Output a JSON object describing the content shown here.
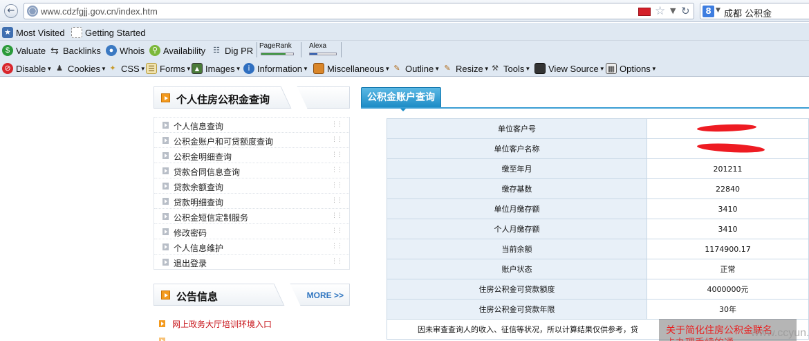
{
  "browser": {
    "url": "www.cdzfgjj.gov.cn/index.htm",
    "search_text": "成都 公积金",
    "search_engine_icon": "8"
  },
  "bookmarks": [
    {
      "label": "Most Visited",
      "icon": "bookmarks-icon"
    },
    {
      "label": "Getting Started",
      "icon": "page-icon"
    }
  ],
  "seo_toolbar": {
    "items": [
      {
        "label": "Valuate",
        "icon": "dollar-icon"
      },
      {
        "label": "Backlinks",
        "icon": "arrows-icon"
      },
      {
        "label": "Whois",
        "icon": "globe-icon"
      },
      {
        "label": "Availability",
        "icon": "magnifier-icon"
      },
      {
        "label": "Dig PR",
        "icon": "network-icon"
      }
    ],
    "pagerank_label": "PageRank",
    "alexa_label": "Alexa",
    "pagerank_level": 0.75,
    "alexa_level": 0.3
  },
  "webdev_toolbar": {
    "items": [
      "Disable",
      "Cookies",
      "CSS",
      "Forms",
      "Images",
      "Information",
      "Miscellaneous",
      "Outline",
      "Resize",
      "Tools",
      "View Source",
      "Options"
    ]
  },
  "sidebar": {
    "title": "个人住房公积金查询",
    "items": [
      "个人信息查询",
      "公积金账户和可贷额度查询",
      "公积金明细查询",
      "贷款合同信息查询",
      "贷款余额查询",
      "贷款明细查询",
      "公积金短信定制服务",
      "修改密码",
      "个人信息维护",
      "退出登录"
    ]
  },
  "notices": {
    "title": "公告信息",
    "more": "MORE >>",
    "items": [
      "网上政务大厅培训环境入口"
    ]
  },
  "account": {
    "tab": "公积金账户查询",
    "rows": [
      {
        "k": "单位客户号",
        "v": ""
      },
      {
        "k": "单位客户名称",
        "v": ""
      },
      {
        "k": "缴至年月",
        "v": "201211"
      },
      {
        "k": "缴存基数",
        "v": "22840"
      },
      {
        "k": "单位月缴存额",
        "v": "3410"
      },
      {
        "k": "个人月缴存额",
        "v": "3410"
      },
      {
        "k": "当前余额",
        "v": "1174900.17"
      },
      {
        "k": "账户状态",
        "v": "正常"
      },
      {
        "k": "住房公积金可贷款额度",
        "v": "4000000元"
      },
      {
        "k": "住房公积金可贷款年限",
        "v": "30年"
      }
    ],
    "note": "因未审查查询人的收入、征信等状况，所以计算结果仅供参考，贷"
  },
  "popup": {
    "line1": "关于简化住房公积金联名",
    "line2": "卡办理手续的通"
  },
  "watermark": "www.ccyun.org",
  "colors": {
    "accent_blue": "#1d8cc6",
    "notice_red": "#c8151b",
    "bullet_orange": "#f39a1e",
    "redaction_red": "#ee1b22"
  }
}
